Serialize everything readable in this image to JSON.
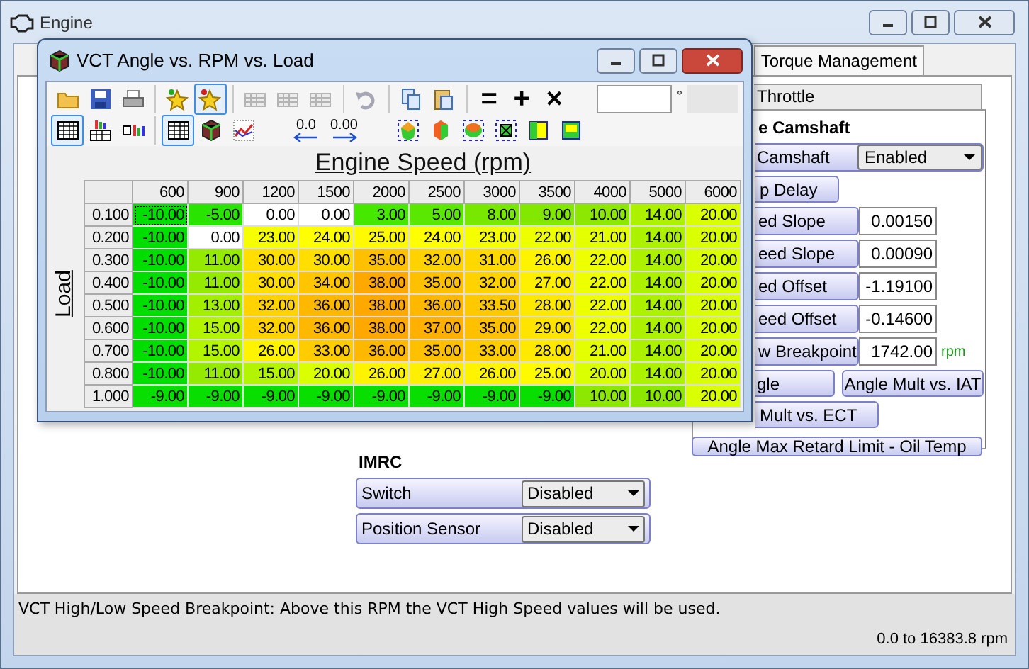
{
  "engine_window": {
    "title": "Engine"
  },
  "tabs": [
    {
      "label": "Torque Management"
    }
  ],
  "subtabs": [
    {
      "label": "Throttle"
    }
  ],
  "camshaft": {
    "heading": "e Camshaft",
    "rows": [
      {
        "kind": "select",
        "label": "Camshaft",
        "value": "Enabled"
      },
      {
        "kind": "button",
        "label": "p Delay"
      },
      {
        "kind": "field",
        "label": "ed Slope",
        "value": "0.00150"
      },
      {
        "kind": "field",
        "label": "eed Slope",
        "value": "0.00090"
      },
      {
        "kind": "field",
        "label": "ed Offset",
        "value": "-1.19100"
      },
      {
        "kind": "field",
        "label": "eed Offset",
        "value": "-0.14600"
      },
      {
        "kind": "field",
        "label": "w Breakpoint",
        "value": "1742.00",
        "unit": "rpm"
      },
      {
        "kind": "pair",
        "buttons": [
          "gle",
          "Angle Mult vs. IAT"
        ]
      },
      {
        "kind": "button",
        "label": "Mult vs. ECT"
      },
      {
        "kind": "wide",
        "label": "Angle Max Retard Limit - Oil Temp"
      }
    ]
  },
  "imrc": {
    "heading": "IMRC",
    "rows": [
      {
        "label": "Switch",
        "value": "Disabled"
      },
      {
        "label": "Position Sensor",
        "value": "Disabled"
      }
    ]
  },
  "status": {
    "message": "VCT High/Low Speed Breakpoint: Above this RPM the VCT High Speed values will be used.",
    "range": "0.0 to 16383.8 rpm"
  },
  "table_window": {
    "title": "VCT Angle vs. RPM vs. Load",
    "toolbar_groups": [
      [
        {
          "kind": "folder",
          "selected": false,
          "disabled": false
        },
        {
          "kind": "save",
          "selected": false,
          "disabled": false
        },
        {
          "kind": "print",
          "selected": false,
          "disabled": false
        }
      ],
      [
        {
          "kind": "star-new",
          "selected": false,
          "disabled": false
        },
        {
          "kind": "star",
          "selected": true,
          "disabled": false
        }
      ],
      [
        {
          "kind": "grid",
          "selected": false,
          "disabled": true
        },
        {
          "kind": "grid",
          "selected": false,
          "disabled": true
        },
        {
          "kind": "grid",
          "selected": false,
          "disabled": true
        }
      ],
      [
        {
          "kind": "undo",
          "selected": false,
          "disabled": true
        }
      ],
      [
        {
          "kind": "copy",
          "selected": false,
          "disabled": false
        },
        {
          "kind": "paste",
          "selected": false,
          "disabled": false
        }
      ],
      [
        {
          "kind": "glyph",
          "text": "=",
          "selected": false,
          "disabled": false
        },
        {
          "kind": "glyph",
          "text": "+",
          "selected": false,
          "disabled": false
        },
        {
          "kind": "glyph",
          "text": "×",
          "selected": false,
          "disabled": false
        }
      ]
    ],
    "value_unit": "°",
    "toolbar2_groups": [
      [
        {
          "kind": "table",
          "selected": true
        },
        {
          "kind": "bars-table",
          "selected": false
        },
        {
          "kind": "small-bars",
          "selected": false
        }
      ],
      [
        {
          "kind": "table",
          "selected": true
        },
        {
          "kind": "cube",
          "selected": false
        },
        {
          "kind": "chart",
          "selected": false
        }
      ],
      [
        {
          "kind": "decimal-left",
          "text": "0.0",
          "selected": false
        },
        {
          "kind": "decimal-right",
          "text": "0.00",
          "selected": false
        }
      ],
      [
        {
          "kind": "surface-a",
          "selected": false
        },
        {
          "kind": "surface-b",
          "selected": false
        },
        {
          "kind": "surface-c",
          "selected": false
        },
        {
          "kind": "frame-x",
          "selected": false
        },
        {
          "kind": "frame-v",
          "selected": false
        },
        {
          "kind": "frame-h",
          "selected": false
        }
      ]
    ],
    "x_axis_label": "Engine Speed (rpm)",
    "y_axis_label": "Load",
    "columns": [
      "600",
      "900",
      "1200",
      "1500",
      "2000",
      "2500",
      "3000",
      "3500",
      "4000",
      "5000",
      "6000"
    ],
    "rows": [
      {
        "load": "0.100",
        "cells": [
          {
            "value": "-10.00",
            "selected": true
          },
          {
            "value": "-5.00",
            "selected": false
          },
          {
            "value": "0.00",
            "selected": false
          },
          {
            "value": "0.00",
            "selected": false
          },
          {
            "value": "3.00",
            "selected": false
          },
          {
            "value": "5.00",
            "selected": false
          },
          {
            "value": "8.00",
            "selected": false
          },
          {
            "value": "9.00",
            "selected": false
          },
          {
            "value": "10.00",
            "selected": false
          },
          {
            "value": "14.00",
            "selected": false
          },
          {
            "value": "20.00",
            "selected": false
          }
        ]
      },
      {
        "load": "0.200",
        "cells": [
          {
            "value": "-10.00",
            "selected": false
          },
          {
            "value": "0.00",
            "selected": false
          },
          {
            "value": "23.00",
            "selected": false
          },
          {
            "value": "24.00",
            "selected": false
          },
          {
            "value": "25.00",
            "selected": false
          },
          {
            "value": "24.00",
            "selected": false
          },
          {
            "value": "23.00",
            "selected": false
          },
          {
            "value": "22.00",
            "selected": false
          },
          {
            "value": "21.00",
            "selected": false
          },
          {
            "value": "14.00",
            "selected": false
          },
          {
            "value": "20.00",
            "selected": false
          }
        ]
      },
      {
        "load": "0.300",
        "cells": [
          {
            "value": "-10.00",
            "selected": false
          },
          {
            "value": "11.00",
            "selected": false
          },
          {
            "value": "30.00",
            "selected": false
          },
          {
            "value": "30.00",
            "selected": false
          },
          {
            "value": "35.00",
            "selected": false
          },
          {
            "value": "32.00",
            "selected": false
          },
          {
            "value": "31.00",
            "selected": false
          },
          {
            "value": "26.00",
            "selected": false
          },
          {
            "value": "22.00",
            "selected": false
          },
          {
            "value": "14.00",
            "selected": false
          },
          {
            "value": "20.00",
            "selected": false
          }
        ]
      },
      {
        "load": "0.400",
        "cells": [
          {
            "value": "-10.00",
            "selected": false
          },
          {
            "value": "11.00",
            "selected": false
          },
          {
            "value": "30.00",
            "selected": false
          },
          {
            "value": "34.00",
            "selected": false
          },
          {
            "value": "38.00",
            "selected": false
          },
          {
            "value": "35.00",
            "selected": false
          },
          {
            "value": "32.00",
            "selected": false
          },
          {
            "value": "27.00",
            "selected": false
          },
          {
            "value": "22.00",
            "selected": false
          },
          {
            "value": "14.00",
            "selected": false
          },
          {
            "value": "20.00",
            "selected": false
          }
        ]
      },
      {
        "load": "0.500",
        "cells": [
          {
            "value": "-10.00",
            "selected": false
          },
          {
            "value": "13.00",
            "selected": false
          },
          {
            "value": "32.00",
            "selected": false
          },
          {
            "value": "36.00",
            "selected": false
          },
          {
            "value": "38.00",
            "selected": false
          },
          {
            "value": "36.00",
            "selected": false
          },
          {
            "value": "33.50",
            "selected": false
          },
          {
            "value": "28.00",
            "selected": false
          },
          {
            "value": "22.00",
            "selected": false
          },
          {
            "value": "14.00",
            "selected": false
          },
          {
            "value": "20.00",
            "selected": false
          }
        ]
      },
      {
        "load": "0.600",
        "cells": [
          {
            "value": "-10.00",
            "selected": false
          },
          {
            "value": "15.00",
            "selected": false
          },
          {
            "value": "32.00",
            "selected": false
          },
          {
            "value": "36.00",
            "selected": false
          },
          {
            "value": "38.00",
            "selected": false
          },
          {
            "value": "37.00",
            "selected": false
          },
          {
            "value": "35.00",
            "selected": false
          },
          {
            "value": "29.00",
            "selected": false
          },
          {
            "value": "22.00",
            "selected": false
          },
          {
            "value": "14.00",
            "selected": false
          },
          {
            "value": "20.00",
            "selected": false
          }
        ]
      },
      {
        "load": "0.700",
        "cells": [
          {
            "value": "-10.00",
            "selected": false
          },
          {
            "value": "15.00",
            "selected": false
          },
          {
            "value": "26.00",
            "selected": false
          },
          {
            "value": "33.00",
            "selected": false
          },
          {
            "value": "36.00",
            "selected": false
          },
          {
            "value": "35.00",
            "selected": false
          },
          {
            "value": "33.00",
            "selected": false
          },
          {
            "value": "28.00",
            "selected": false
          },
          {
            "value": "21.00",
            "selected": false
          },
          {
            "value": "14.00",
            "selected": false
          },
          {
            "value": "20.00",
            "selected": false
          }
        ]
      },
      {
        "load": "0.800",
        "cells": [
          {
            "value": "-10.00",
            "selected": false
          },
          {
            "value": "11.00",
            "selected": false
          },
          {
            "value": "15.00",
            "selected": false
          },
          {
            "value": "20.00",
            "selected": false
          },
          {
            "value": "26.00",
            "selected": false
          },
          {
            "value": "27.00",
            "selected": false
          },
          {
            "value": "26.00",
            "selected": false
          },
          {
            "value": "25.00",
            "selected": false
          },
          {
            "value": "20.00",
            "selected": false
          },
          {
            "value": "14.00",
            "selected": false
          },
          {
            "value": "20.00",
            "selected": false
          }
        ]
      },
      {
        "load": "1.000",
        "cells": [
          {
            "value": "-9.00",
            "selected": false
          },
          {
            "value": "-9.00",
            "selected": false
          },
          {
            "value": "-9.00",
            "selected": false
          },
          {
            "value": "-9.00",
            "selected": false
          },
          {
            "value": "-9.00",
            "selected": false
          },
          {
            "value": "-9.00",
            "selected": false
          },
          {
            "value": "-9.00",
            "selected": false
          },
          {
            "value": "-9.00",
            "selected": false
          },
          {
            "value": "10.00",
            "selected": false
          },
          {
            "value": "10.00",
            "selected": false
          },
          {
            "value": "20.00",
            "selected": false
          }
        ]
      }
    ]
  }
}
